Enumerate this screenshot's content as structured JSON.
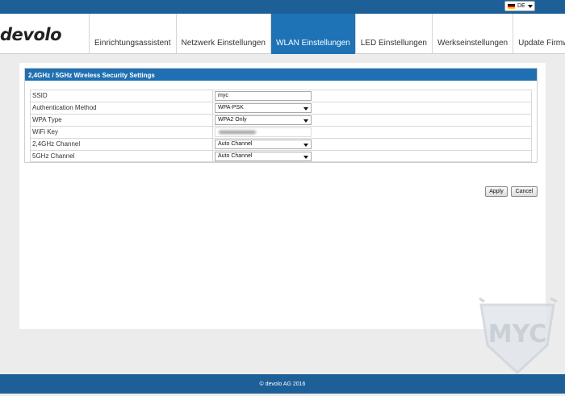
{
  "header": {
    "language": {
      "label": "DE",
      "flag": "germany-flag-icon"
    }
  },
  "brand": {
    "logo_text": "devolo"
  },
  "nav": {
    "tabs": [
      {
        "label": "Einrichtungsassistent"
      },
      {
        "label": "Netzwerk Einstellungen"
      },
      {
        "label": "WLAN Einstellungen",
        "active": true
      },
      {
        "label": "LED Einstellungen"
      },
      {
        "label": "Werkseinstellungen"
      },
      {
        "label": "Update Firmware"
      }
    ]
  },
  "section": {
    "title": "2,4GHz / 5GHz Wireless Security Settings",
    "rows": [
      {
        "label": "SSID",
        "value": "myc"
      },
      {
        "label": "Authentication Method",
        "value": "WPA-PSK"
      },
      {
        "label": "WPA Type",
        "value": "WPA2 Only"
      },
      {
        "label": "WiFi Key",
        "value": ""
      },
      {
        "label": "2,4GHz Channel",
        "value": "Auto Channel"
      },
      {
        "label": "5GHz Channel",
        "value": "Auto Channel"
      }
    ]
  },
  "actions": {
    "apply_label": "Apply",
    "cancel_label": "Cancel"
  },
  "footer": {
    "copyright": "© devolo AG 2016"
  },
  "colors": {
    "primary_blue": "#1d5f97",
    "active_tab": "#1d73b6",
    "section_header": "#1f6fb2"
  },
  "watermark": {
    "text": "MYC"
  }
}
